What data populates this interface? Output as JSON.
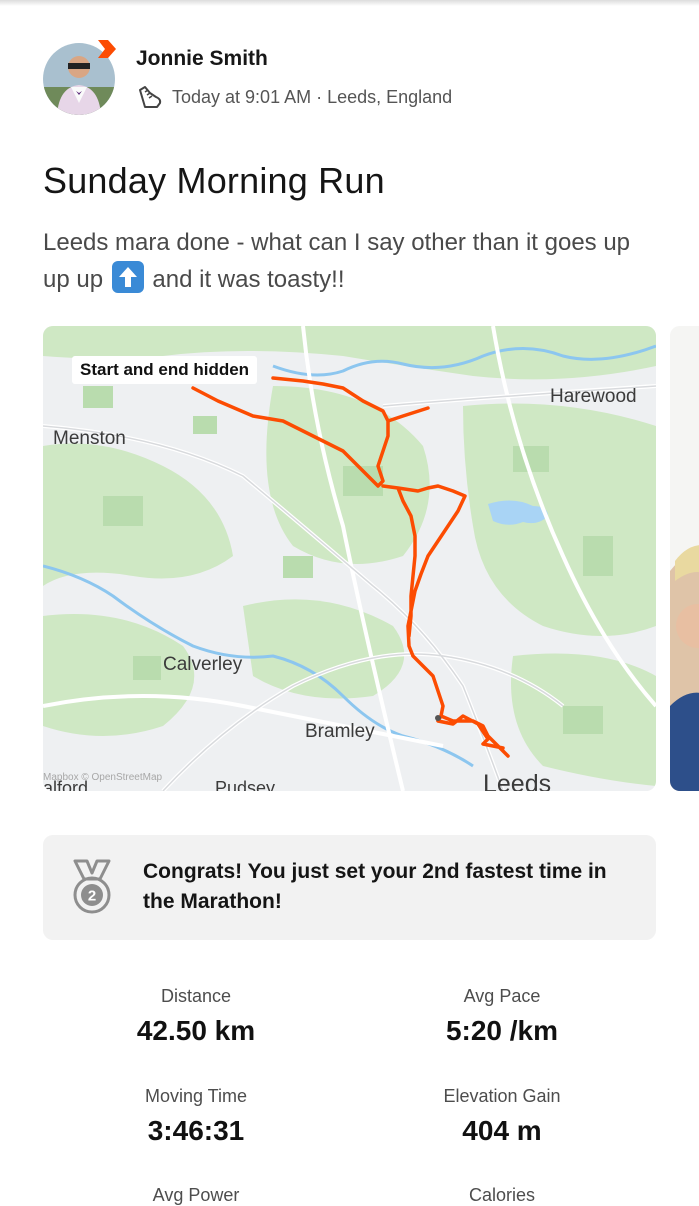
{
  "header": {
    "athlete_name": "Jonnie Smith",
    "meta": "Today at 9:01 AM · Leeds, England",
    "activity_icon": "running-shoe-icon",
    "badge_color": "#fc4c02"
  },
  "activity": {
    "title": "Sunday Morning Run",
    "description_part1": "Leeds mara done - what can I say other than it goes up up up",
    "description_part2": "and it was toasty!!"
  },
  "map": {
    "privacy_label": "Start and end hidden",
    "route_color": "#fc4c02",
    "places": {
      "menston": "Menston",
      "harewood": "Harewood",
      "calverley": "Calverley",
      "bramley": "Bramley",
      "leeds": "Leeds",
      "pudsey": "Pudsey",
      "fragment": "alford"
    },
    "attribution": "Mapbox © OpenStreetMap"
  },
  "achievement": {
    "icon": "silver-medal-icon",
    "text": "Congrats! You just set your 2nd fastest time in the Marathon!"
  },
  "stats": [
    {
      "label": "Distance",
      "value": "42.50 km"
    },
    {
      "label": "Avg Pace",
      "value": "5:20 /km"
    },
    {
      "label": "Moving Time",
      "value": "3:46:31"
    },
    {
      "label": "Elevation Gain",
      "value": "404 m"
    },
    {
      "label": "Avg Power",
      "value": ""
    },
    {
      "label": "Calories",
      "value": ""
    }
  ]
}
